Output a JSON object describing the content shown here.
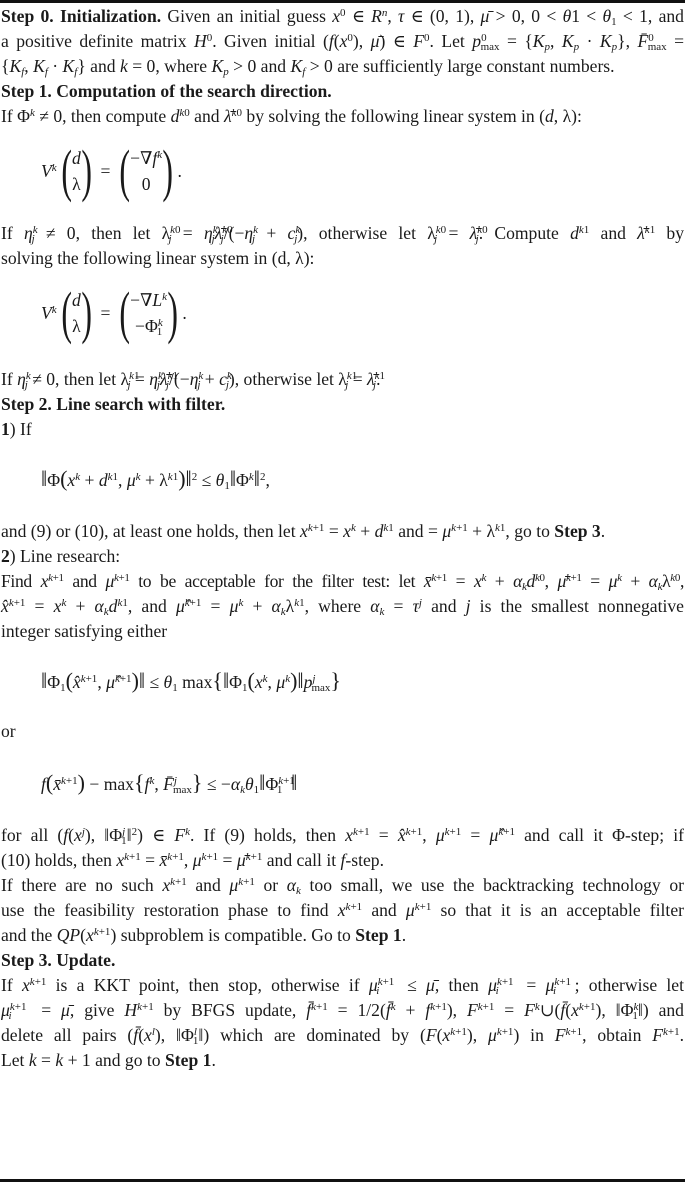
{
  "step0": {
    "title": "Step 0. Initialization.",
    "line1_text": "Given an initial guess x⁰ ∈ Rⁿ, τ ∈ (0, 1), μ̄ > 0, 0 < θ1 < θ₁ < 1, and",
    "line2_text": "a positive definite matrix H⁰. Given initial (f(x⁰), μ̄) ∈ F⁰. Let p⁰max = {Kp, Kp · Kp}, F̄⁰max =",
    "line3_text": "{Kf, Kf · Kf} and k = 0, where Kp > 0 and Kf > 0 are sufficiently large constant numbers."
  },
  "step1": {
    "title": "Step 1. Computation of the search direction.",
    "intro": "If Φᵏ ≠ 0, then compute dᵏ⁰ and λ̄ᵏ⁰ by solving the following linear system in (d, λ):",
    "eq1": {
      "lhs": "Vᵏ",
      "vec_top": "d",
      "vec_bottom": "λ",
      "rhs_top": "−∇fᵏ",
      "rhs_bottom": "0"
    },
    "middle_line1": "If ηⱼᵏ ≠ 0, then let λⱼᵏ⁰ = ηⱼᵏλ̄ⱼᵏ⁰/(−ηⱼᵏ + cⱼᵏ), otherwise let λⱼᵏ⁰ = λ̄ⱼᵏ⁰. Compute dᵏ¹ and λ̄ᵏ¹ by",
    "middle_line2": "solving the following linear system in (d, λ):",
    "eq2": {
      "lhs": "Vᵏ",
      "vec_top": "d",
      "vec_bottom": "λ",
      "rhs_top": "−∇Lᵏ",
      "rhs_bottom": "−Φ₁ᵏ"
    },
    "outro": "If ηⱼᵏ ≠ 0, then let λⱼᵏ¹ = ηⱼᵏλ̄ⱼᵏ¹/(−ηⱼᵏ + cⱼᵏ), otherwise let λⱼᵏ¹ = λ̄ⱼᵏ¹."
  },
  "step2": {
    "title": "Step 2. Line search with filter.",
    "item1_label": "1",
    "item1_text": ") If",
    "eq3": "‖Φ(xᵏ + dᵏ¹, μᵏ + λᵏ¹)‖² ≤ θ₁‖Φᵏ‖²,",
    "after_eq3_a": "and (9) or (10), at least one holds, then let xᵏ⁺¹ = xᵏ + dᵏ¹ and = μᵏ⁺¹ + λᵏ¹, go to ",
    "after_eq3_link": "Step 3",
    "item2_label": "2",
    "item2_text": ") Line research:",
    "find_line1": "Find xᵏ⁺¹ and μᵏ⁺¹ to be acceptable for the filter test: let x̄ᵏ⁺¹ = xᵏ + αₖdᵏ⁰, μ̄ᵏ⁺¹ = μᵏ + αₖλᵏ⁰,",
    "find_line2": "x̂ᵏ⁺¹ = xᵏ + αₖdᵏ¹, and μ̂ᵏ⁺¹ = μᵏ + αₖλᵏ¹, where αₖ = τʲ and j is the smallest nonnegative",
    "find_line3": "integer satisfying either",
    "eq4": "‖Φ₁(x̂ᵏ⁺¹, μ̂ᵏ⁺¹)‖ ≤ θ₁ max{‖Φ₁(xᵏ, μᵏ)‖pʲmax}",
    "or_label": "or",
    "eq5": "f(x̄ᵏ⁺¹) − max{fᵏ, F̄ʲmax} ≤ −αₖθ₁‖Φ₁ᵏ⁺¹‖",
    "forall_line1": "for all (f(xʲ), ‖Φ₁ʲ‖²) ∈ Fᵏ. If (9) holds, then xᵏ⁺¹ = x̂ᵏ⁺¹, μᵏ⁺¹ = μ̂ᵏ⁺¹ and call it Φ-step; if",
    "forall_line2": "(10) holds, then xᵏ⁺¹ = x̄ᵏ⁺¹, μᵏ⁺¹ = μ̄ᵏ⁺¹ and call it f-step.",
    "noSuch_line1": "If there are no such xᵏ⁺¹ and μᵏ⁺¹ or αₖ too small, we use the backtracking technology or",
    "noSuch_line2": "use the feasibility restoration phase to find xᵏ⁺¹ and μᵏ⁺¹ so that it is an acceptable filter",
    "noSuch_line3_a": "and the QP(xᵏ⁺¹) subproblem is compatible. Go to ",
    "noSuch_line3_link": "Step 1"
  },
  "step3": {
    "title": "Step 3. Update.",
    "line1": "If xᵏ⁺¹ is a KKT point, then stop, otherwise if μᵢᵏ⁺¹ ≤ μ̄, then μᵢᵏ⁺¹ = μᵢᵏ⁺¹; otherwise let",
    "line2": "μᵢᵏ⁺¹ = μ̄, give Hᵏ⁺¹ by BFGS update, f̄ᵏ⁺¹ = 1/2(f̄ᵏ + fᵏ⁺¹), Fᵏ⁺¹ = Fᵏ∪(f̄(xᵏ⁺¹), ‖Φ₁ᵏ‖) and",
    "line3": "delete all pairs (f̄(xˡ), ‖Φ₁ˡ‖) which are dominated by (F(xᵏ⁺¹), μᵏ⁺¹) in Fᵏ⁺¹, obtain Fᵏ⁺¹.",
    "line4_a": "Let k = k + 1 and go to ",
    "line4_link": "Step 1"
  }
}
